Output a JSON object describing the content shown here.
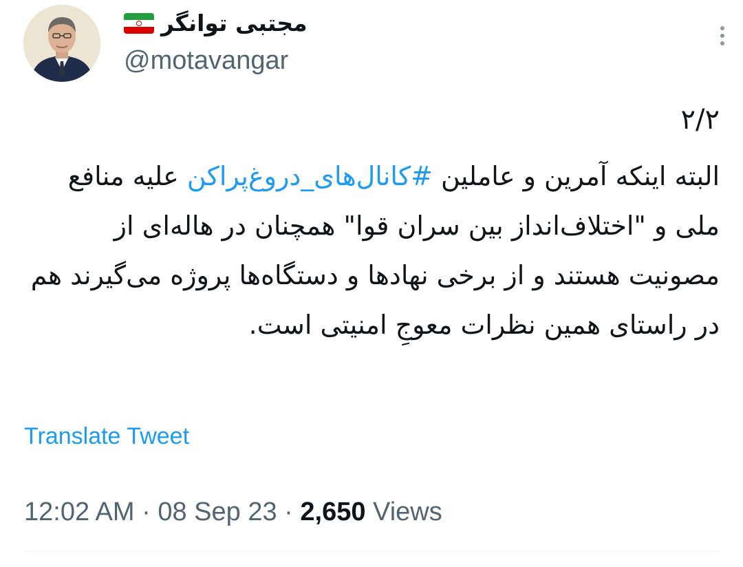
{
  "author": {
    "display_name": "مجتبی توانگر",
    "handle": "@motavangar",
    "flag": {
      "top_color": "#239f40",
      "middle_color": "#ffffff",
      "bottom_color": "#da0000"
    }
  },
  "tweet": {
    "thread_number": "۲/۲",
    "text_before_hashtag": "البته اینکه آمرین و عاملین ",
    "hashtag": "#کانال‌های_دروغ‌پراکن",
    "text_after_hashtag": " علیه منافع ملی و \"اختلاف‌انداز بین سران قوا\" همچنان در هاله‌ای از مصونیت هستند و از برخی نهادها و دستگاه‌ها پروژه می‌گیرند هم در راستای همین نظرات معوجِ امنیتی است.",
    "translate_label": "Translate Tweet"
  },
  "meta": {
    "time": "12:02 AM",
    "separator": "·",
    "date": "08 Sep 23",
    "views_count": "2,650",
    "views_label": "Views"
  },
  "icons": {
    "more": "more-vertical-icon",
    "flag": "iran-flag-icon"
  },
  "colors": {
    "link": "#1d9bf0",
    "secondary_text": "#536471",
    "primary_text": "#0f1419"
  }
}
